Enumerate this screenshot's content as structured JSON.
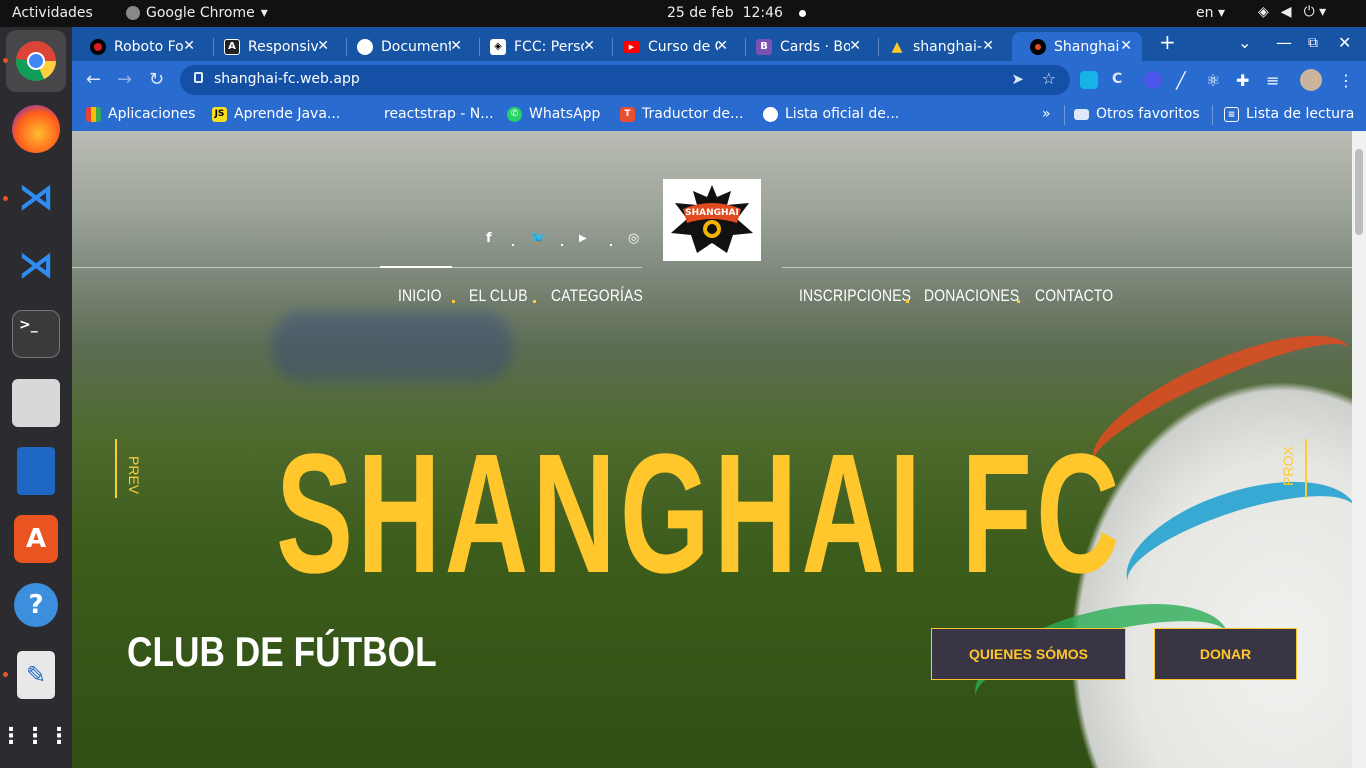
{
  "os": {
    "activities": "Actividades",
    "app_name": "Google Chrome",
    "date": "25 de feb",
    "time": "12:46",
    "language": "en"
  },
  "browser": {
    "tabs": [
      {
        "title": "Roboto Fo",
        "icon": "record-icon",
        "color": "#e01b24"
      },
      {
        "title": "Responsiv",
        "icon": "angular-icon",
        "color": "#222222"
      },
      {
        "title": "Document",
        "icon": "globe-icon",
        "color": "#ffffff"
      },
      {
        "title": "FCC: Perso",
        "icon": "freecodecamp-icon",
        "color": "#ffffff"
      },
      {
        "title": "Curso de C",
        "icon": "youtube-icon",
        "color": "#ff0000"
      },
      {
        "title": "Cards · Bo",
        "icon": "bootstrap-icon",
        "color": "#7952b3"
      },
      {
        "title": "shanghai-",
        "icon": "firebase-icon",
        "color": "#ffca28"
      },
      {
        "title": "Shanghai",
        "icon": "shanghai-fc-icon",
        "color": "#000000"
      }
    ],
    "url": "shanghai-fc.web.app",
    "bookmarks": [
      {
        "label": "Aplicaciones",
        "icon": "apps-grid-icon"
      },
      {
        "label": "Aprende Java...",
        "icon": "js-icon"
      },
      {
        "label": "reactstrap - N...",
        "icon": "reactstrap-icon"
      },
      {
        "label": "WhatsApp",
        "icon": "whatsapp-icon"
      },
      {
        "label": "Traductor de...",
        "icon": "translate-icon"
      },
      {
        "label": "Lista oficial de...",
        "icon": "globe-icon"
      }
    ],
    "bookmarks_more": "»",
    "other_favorites": "Otros favoritos",
    "reading_list": "Lista de lectura"
  },
  "site": {
    "social": [
      "facebook-icon",
      "twitter-icon",
      "youtube-icon",
      "instagram-icon"
    ],
    "nav_left": [
      "INICIO",
      "EL CLUB",
      "CATEGORÍAS"
    ],
    "nav_right": [
      "INSCRIPCIONES",
      "DONACIONES",
      "CONTACTO"
    ],
    "prev": "PREV",
    "next": "PROX",
    "hero_title": "SHANGHAI FC",
    "hero_subtitle": "CLUB DE FÚTBOL",
    "cta_primary": "QUIENES SÓMOS",
    "cta_secondary": "DONAR",
    "accent_color": "#ffc72c",
    "logo_text": "SHANGHAI FC"
  }
}
